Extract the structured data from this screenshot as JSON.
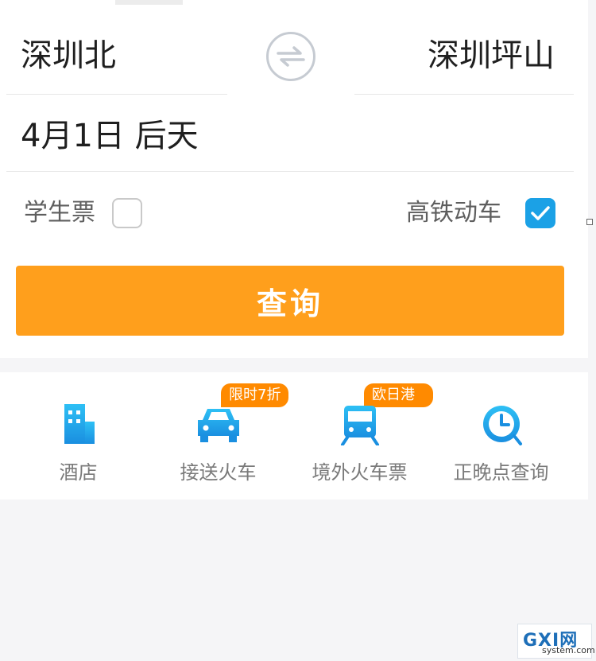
{
  "route": {
    "from_station": "深圳北",
    "to_station": "深圳坪山"
  },
  "date": {
    "text": "4月1日 后天"
  },
  "options": {
    "student_label": "学生票",
    "student_checked": false,
    "hsr_label": "高铁动车",
    "hsr_checked": true
  },
  "query_button": {
    "label": "查询"
  },
  "services": [
    {
      "label": "酒店",
      "icon": "hotel-icon",
      "badge": ""
    },
    {
      "label": "接送火车",
      "icon": "car-icon",
      "badge": "限时7折"
    },
    {
      "label": "境外火车票",
      "icon": "train-icon",
      "badge": "欧日港台"
    },
    {
      "label": "正晚点查询",
      "icon": "clock-icon",
      "badge": ""
    }
  ],
  "watermark": {
    "big": "GXI网",
    "small": "system.com"
  },
  "colors": {
    "accent": "#ff9f1c",
    "checkbox_blue": "#1ba1e6",
    "icon_blue": "#1aa7ec",
    "badge_orange": "#ff8a00"
  }
}
